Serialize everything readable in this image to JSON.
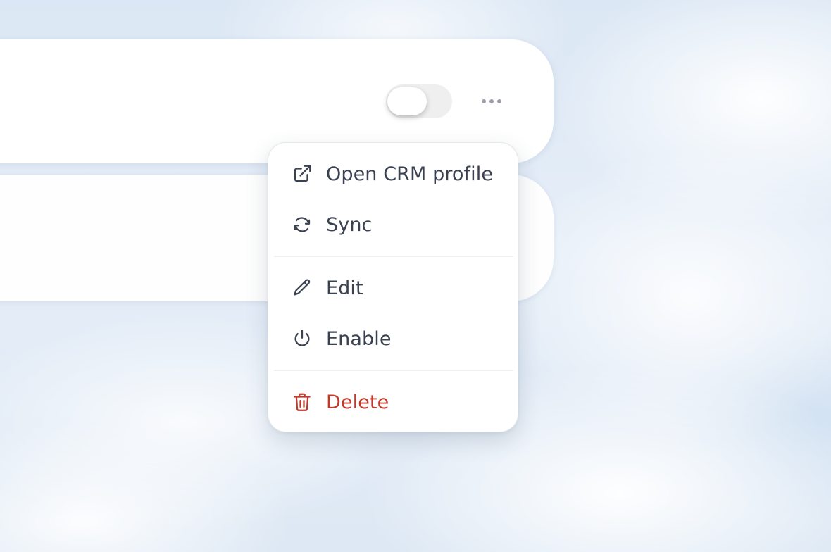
{
  "row_card": {
    "toggle": {
      "state": "off"
    },
    "more_button": {
      "icon": "more-horizontal-icon"
    }
  },
  "menu": {
    "items": [
      {
        "label": "Open CRM profile",
        "icon": "external-link-icon"
      },
      {
        "label": "Sync",
        "icon": "refresh-icon"
      },
      {
        "label": "Edit",
        "icon": "pencil-icon"
      },
      {
        "label": "Enable",
        "icon": "power-icon"
      },
      {
        "label": "Delete",
        "icon": "trash-icon",
        "color": "#c2392c"
      }
    ]
  },
  "colors": {
    "text": "#3a4150",
    "danger": "#c2392c",
    "toggle_track": "#efefef"
  }
}
